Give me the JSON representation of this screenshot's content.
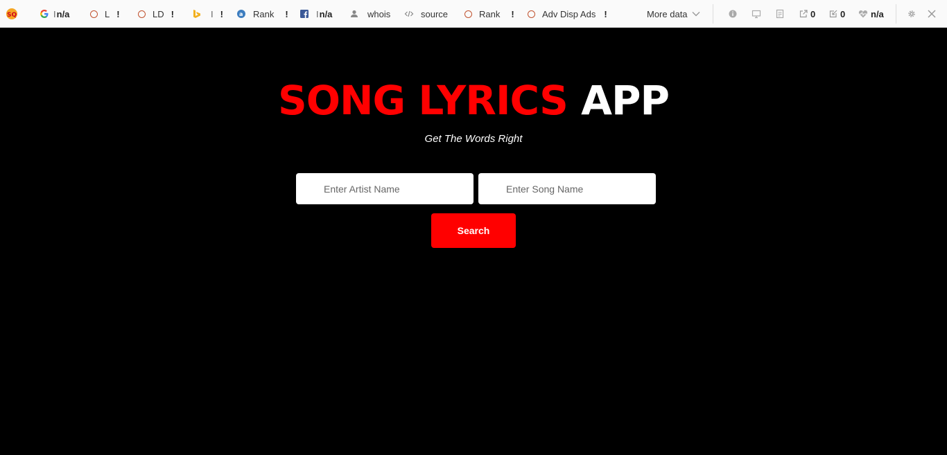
{
  "toolbar": {
    "logo": "SQ",
    "google": {
      "label": "I",
      "value": "n/a"
    },
    "links": {
      "label": "L",
      "alert": "!"
    },
    "ld": {
      "label": "LD",
      "alert": "!"
    },
    "bing": {
      "label": "I",
      "alert": "!"
    },
    "alexa": {
      "label": "Rank",
      "alert": "!"
    },
    "facebook": {
      "label": "I",
      "value": "n/a"
    },
    "whois": {
      "label": "whois"
    },
    "source": {
      "label": "source"
    },
    "rank2": {
      "label": "Rank",
      "alert": "!"
    },
    "adv": {
      "label": "Adv Disp Ads",
      "alert": "!"
    },
    "more_data": {
      "label": "More data"
    },
    "external_links": {
      "value": "0"
    },
    "internal_links": {
      "value": "0"
    },
    "health": {
      "value": "n/a"
    }
  },
  "main": {
    "title_red": "SONG LYRICS",
    "title_white": "APP",
    "subtitle": "Get The Words Right",
    "artist_input": {
      "placeholder": "Enter Artist Name",
      "value": ""
    },
    "song_input": {
      "placeholder": "Enter Song Name",
      "value": ""
    },
    "search_button": "Search"
  },
  "colors": {
    "accent": "#ff0000",
    "background": "#000000",
    "toolbar_bg": "#fafafa"
  }
}
